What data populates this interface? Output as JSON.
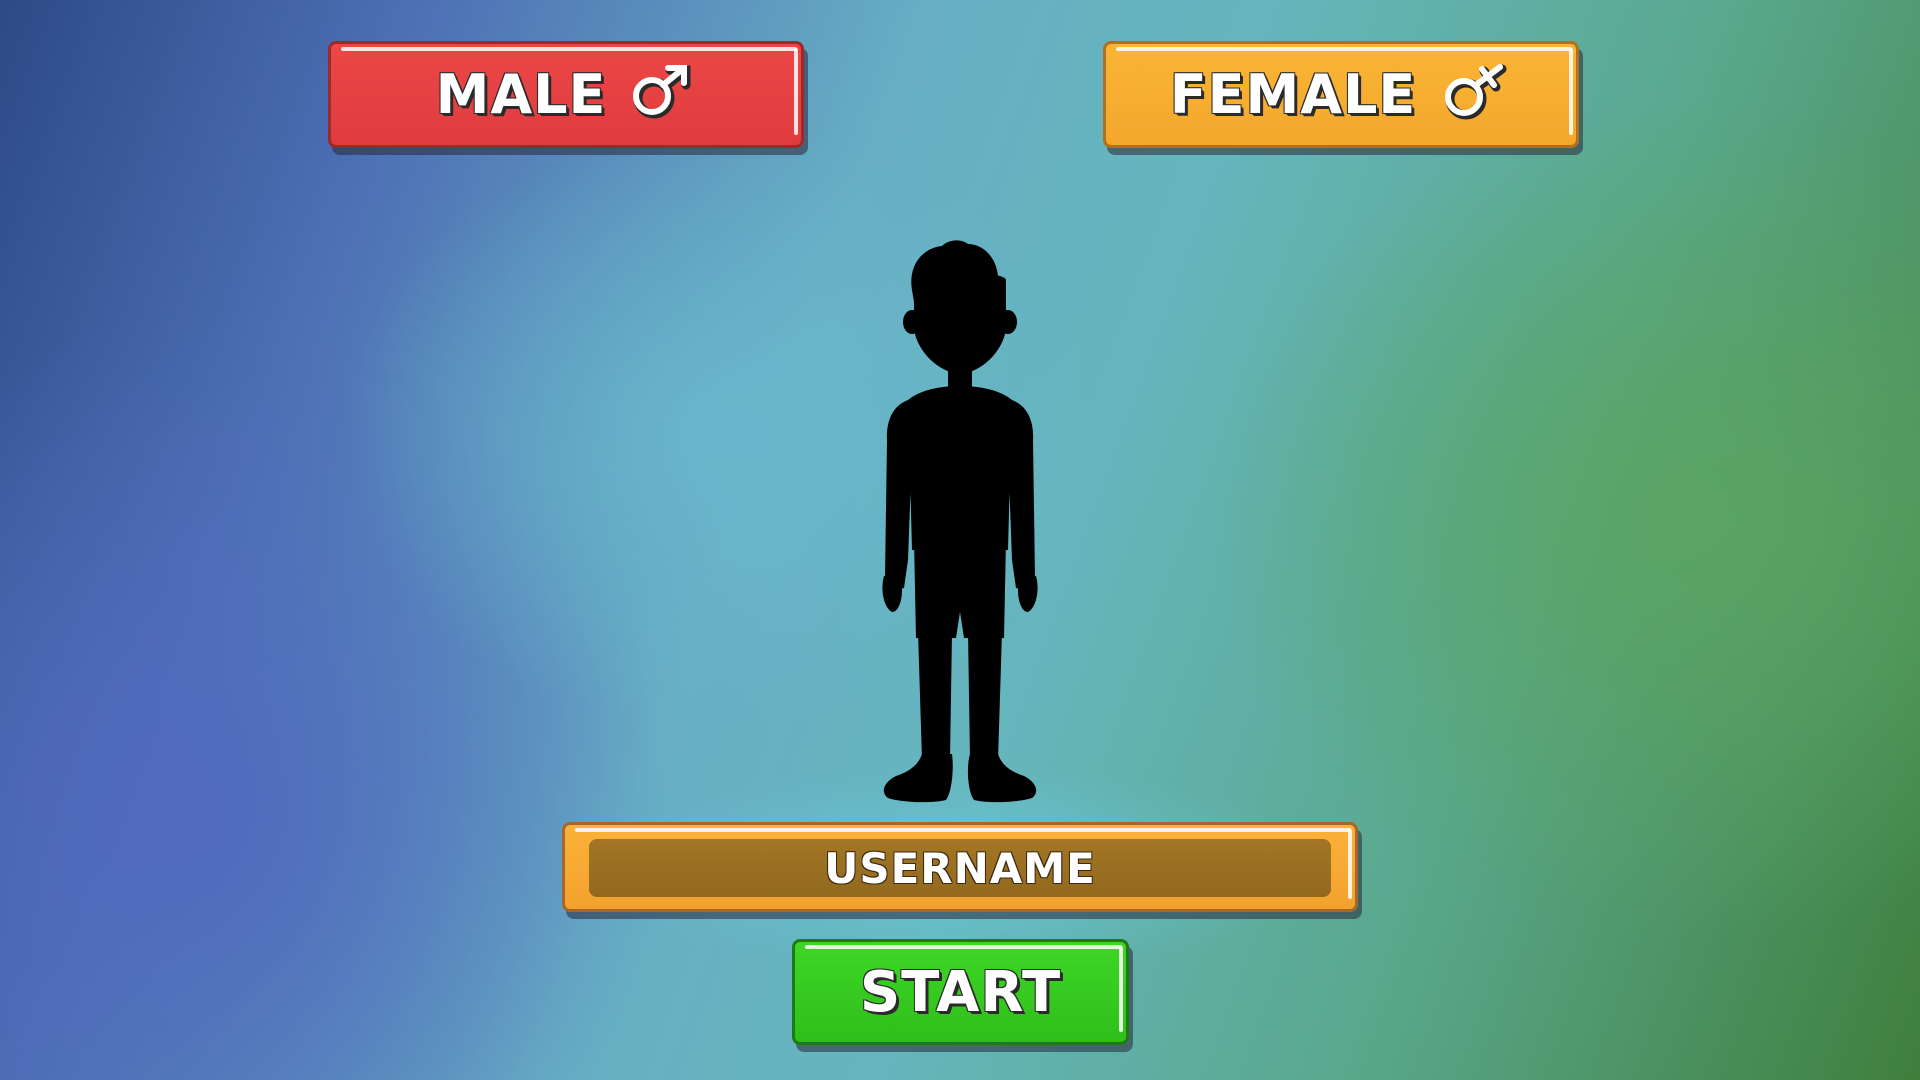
{
  "gender_select": {
    "male_label": "MALE",
    "female_label": "FEMALE"
  },
  "icons": {
    "male": "male-symbol-icon",
    "female": "female-symbol-icon"
  },
  "username": {
    "placeholder": "USERNAME"
  },
  "start": {
    "label": "START"
  },
  "colors": {
    "male_button": "#e84242",
    "female_button": "#f8b133",
    "username_field": "#f7aa30",
    "start_button": "#36c920"
  }
}
